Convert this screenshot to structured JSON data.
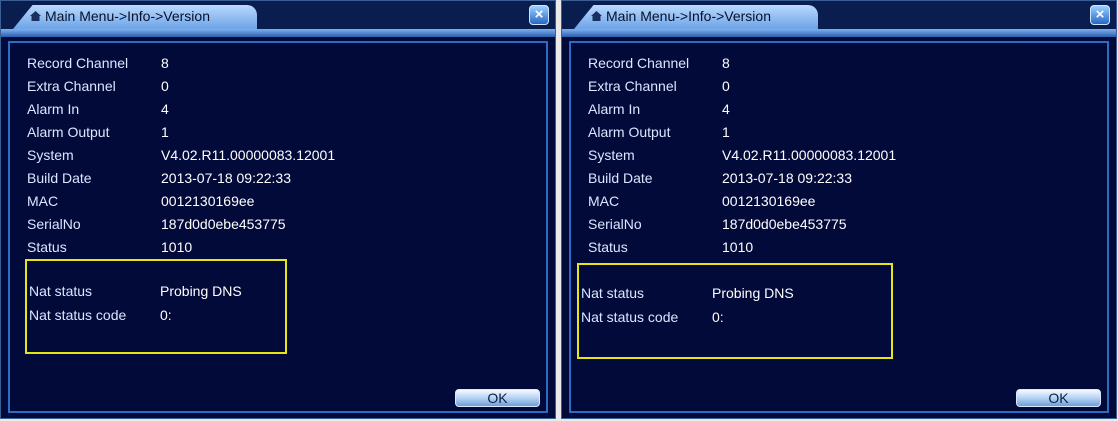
{
  "windows": [
    {
      "title": "Main Menu->Info->Version",
      "rows": [
        {
          "label": "Record Channel",
          "value": "8"
        },
        {
          "label": "Extra Channel",
          "value": "0"
        },
        {
          "label": "Alarm In",
          "value": "4"
        },
        {
          "label": "Alarm Output",
          "value": "1"
        },
        {
          "label": "System",
          "value": "V4.02.R11.00000083.12001"
        },
        {
          "label": "Build Date",
          "value": "2013-07-18 09:22:33"
        },
        {
          "label": "MAC",
          "value": "0012130169ee"
        },
        {
          "label": "SerialNo",
          "value": "187d0d0ebe453775"
        },
        {
          "label": "Status",
          "value": "1010"
        }
      ],
      "nat": [
        {
          "label": "Nat status",
          "value": "Probing DNS"
        },
        {
          "label": "Nat status code",
          "value": "0:"
        }
      ],
      "ok_label": "OK",
      "close_label": "×"
    },
    {
      "title": "Main Menu->Info->Version",
      "rows": [
        {
          "label": "Record Channel",
          "value": "8"
        },
        {
          "label": "Extra Channel",
          "value": "0"
        },
        {
          "label": "Alarm In",
          "value": "4"
        },
        {
          "label": "Alarm Output",
          "value": "1"
        },
        {
          "label": "System",
          "value": "V4.02.R11.00000083.12001"
        },
        {
          "label": "Build Date",
          "value": "2013-07-18 09:22:33"
        },
        {
          "label": "MAC",
          "value": "0012130169ee"
        },
        {
          "label": "SerialNo",
          "value": "187d0d0ebe453775"
        },
        {
          "label": "Status",
          "value": "1010"
        }
      ],
      "nat": [
        {
          "label": "Nat status",
          "value": "Probing DNS"
        },
        {
          "label": "Nat status code",
          "value": "0:"
        }
      ],
      "ok_label": "OK",
      "close_label": "×"
    }
  ],
  "colors": {
    "background": "#020a3a",
    "panel_border": "#2d6cc4",
    "highlight_box": "#e6e617",
    "text": "#ffffff"
  },
  "icons": {
    "title": "home-icon",
    "close": "close-icon"
  }
}
